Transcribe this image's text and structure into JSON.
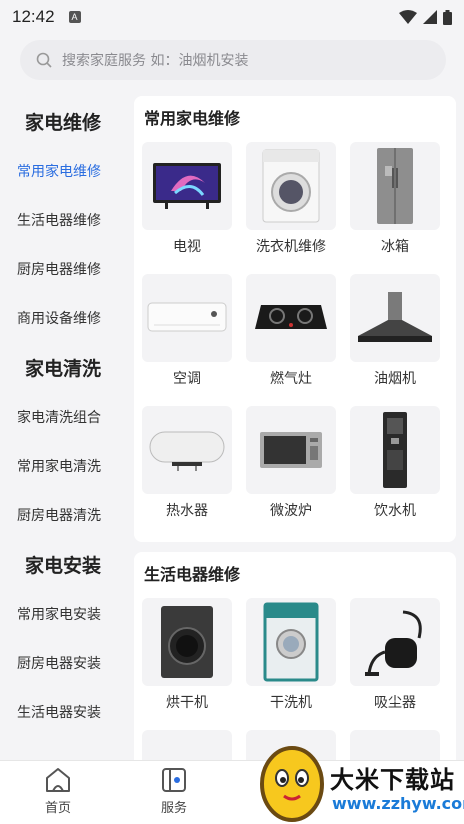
{
  "status": {
    "time": "12:42",
    "notify_icon": "A"
  },
  "search": {
    "placeholder": "搜索家庭服务 如：油烟机安装"
  },
  "sidebar": {
    "groups": [
      {
        "title": "家电维修",
        "items": [
          "常用家电维修",
          "生活电器维修",
          "厨房电器维修",
          "商用设备维修"
        ]
      },
      {
        "title": "家电清洗",
        "items": [
          "家电清洗组合",
          "常用家电清洗",
          "厨房电器清洗"
        ]
      },
      {
        "title": "家电安装",
        "items": [
          "常用家电安装",
          "厨房电器安装",
          "生活电器安装"
        ]
      }
    ],
    "active": "常用家电维修"
  },
  "sections": [
    {
      "title": "常用家电维修",
      "items": [
        {
          "label": "电视",
          "icon": "tv-icon"
        },
        {
          "label": "洗衣机维修",
          "icon": "washing-machine-icon"
        },
        {
          "label": "冰箱",
          "icon": "fridge-icon"
        },
        {
          "label": "空调",
          "icon": "air-conditioner-icon"
        },
        {
          "label": "燃气灶",
          "icon": "gas-stove-icon"
        },
        {
          "label": "油烟机",
          "icon": "range-hood-icon"
        },
        {
          "label": "热水器",
          "icon": "water-heater-icon"
        },
        {
          "label": "微波炉",
          "icon": "microwave-icon"
        },
        {
          "label": "饮水机",
          "icon": "water-dispenser-icon"
        }
      ]
    },
    {
      "title": "生活电器维修",
      "items": [
        {
          "label": "烘干机",
          "icon": "dryer-icon"
        },
        {
          "label": "干洗机",
          "icon": "dry-cleaner-icon"
        },
        {
          "label": "吸尘器",
          "icon": "vacuum-icon"
        }
      ]
    }
  ],
  "nav": {
    "home": "首页",
    "service": "服务"
  },
  "watermark": {
    "text": "大米下载站",
    "url": "www.zzhyw.com"
  },
  "colors": {
    "accent": "#2a6de0",
    "bg": "#f4f4f6"
  }
}
